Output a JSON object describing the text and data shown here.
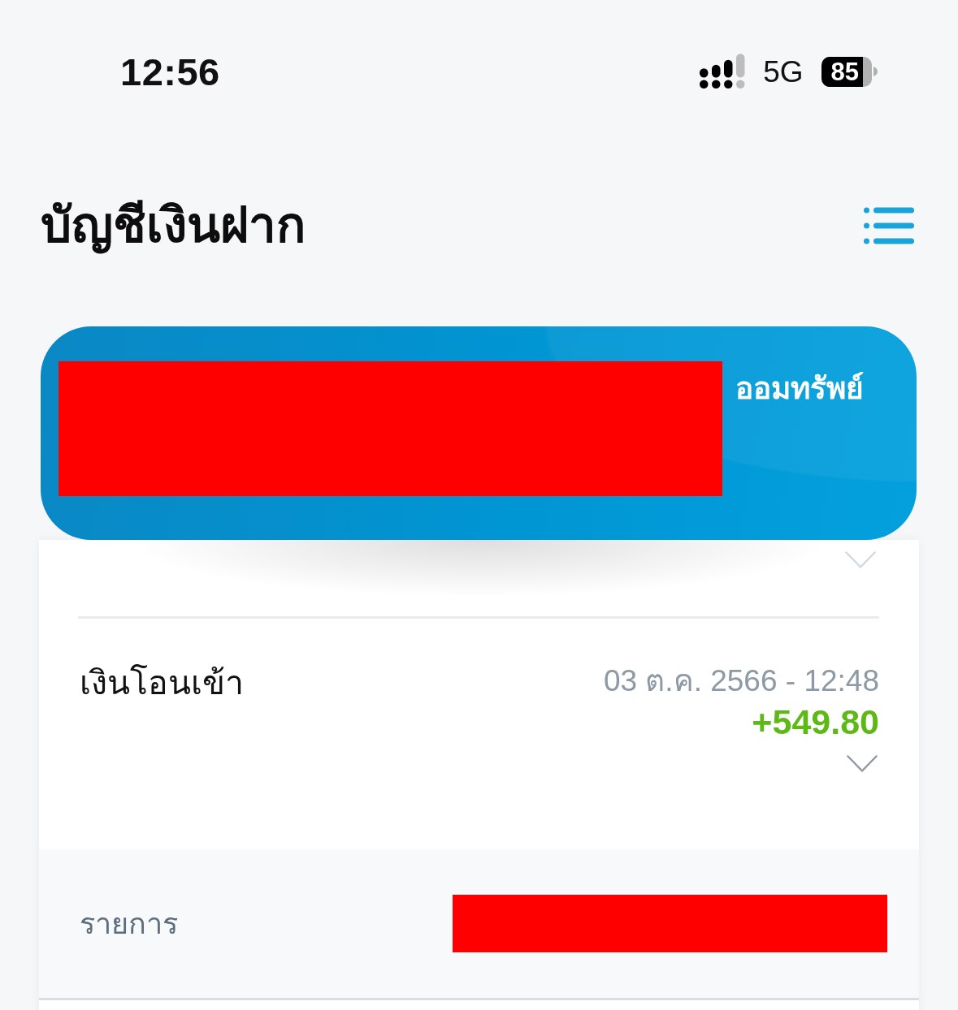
{
  "status_bar": {
    "time": "12:56",
    "network": "5G",
    "battery": "85"
  },
  "header": {
    "title": "บัญชีเงินฝาก"
  },
  "account_card": {
    "account_type": "ออมทรัพย์",
    "redacted": true
  },
  "transaction": {
    "title": "เงินโอนเข้า",
    "datetime": "03 ต.ค. 2566 - 12:48",
    "amount": "+549.80",
    "details": [
      {
        "label": "รายการ",
        "redacted": true
      }
    ]
  }
}
